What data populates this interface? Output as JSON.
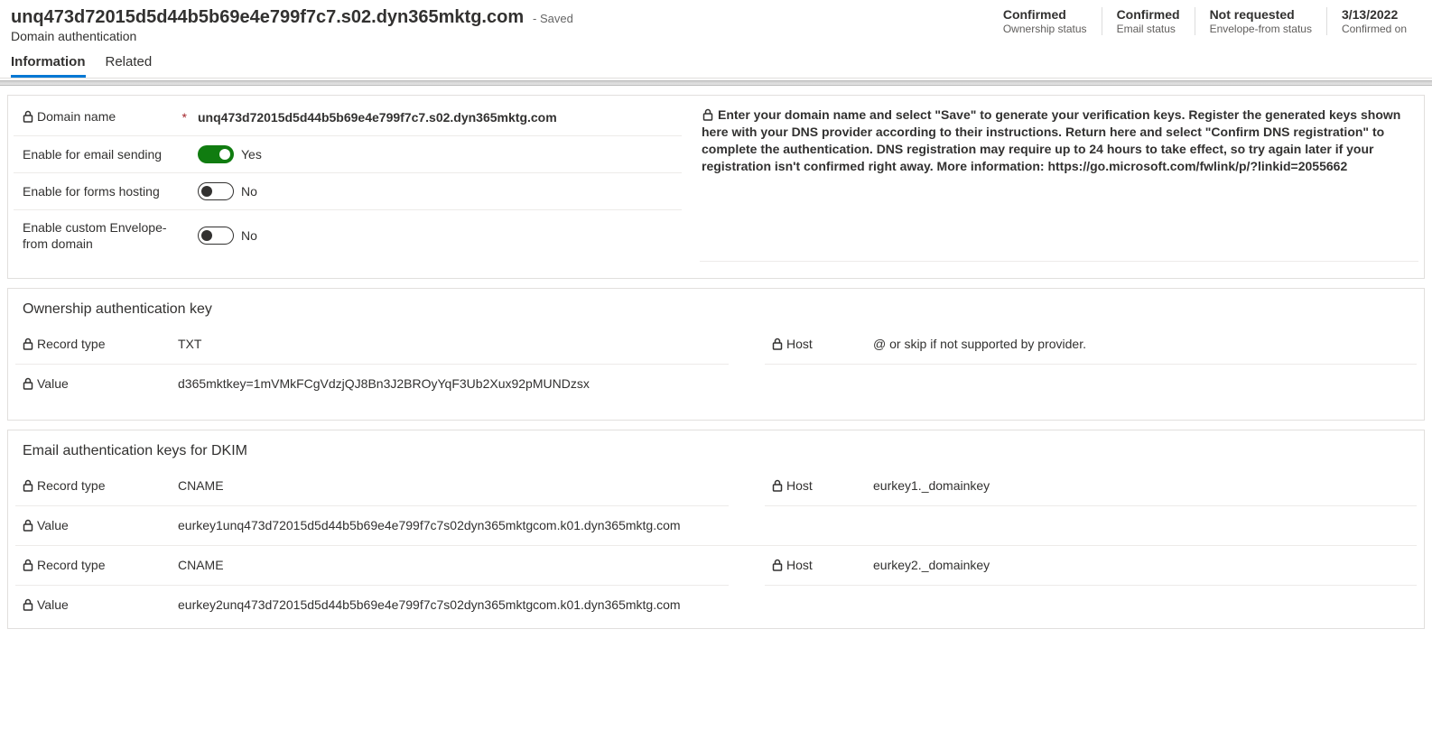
{
  "header": {
    "title": "unq473d72015d5d44b5b69e4e799f7c7.s02.dyn365mktg.com",
    "saved_label": "- Saved",
    "subtitle": "Domain authentication",
    "statuses": [
      {
        "value": "Confirmed",
        "label": "Ownership status"
      },
      {
        "value": "Confirmed",
        "label": "Email status"
      },
      {
        "value": "Not requested",
        "label": "Envelope-from status"
      },
      {
        "value": "3/13/2022",
        "label": "Confirmed on"
      }
    ]
  },
  "tabs": {
    "information": "Information",
    "related": "Related"
  },
  "form": {
    "domain_name_label": "Domain name",
    "domain_name_value": "unq473d72015d5d44b5b69e4e799f7c7.s02.dyn365mktg.com",
    "enable_email_label": "Enable for email sending",
    "enable_email_yes": "Yes",
    "enable_forms_label": "Enable for forms hosting",
    "enable_forms_no": "No",
    "enable_envelope_label": "Enable custom Envelope-from domain",
    "enable_envelope_no": "No",
    "info_banner": "Enter your domain name and select \"Save\" to generate your verification keys. Register the generated keys shown here with your DNS provider according to their instructions. Return here and select \"Confirm DNS registration\" to complete the authentication. DNS registration may require up to 24 hours to take effect, so try again later if your registration isn't confirmed right away. More information: https://go.microsoft.com/fwlink/p/?linkid=2055662"
  },
  "ownership": {
    "heading": "Ownership authentication key",
    "record_type_label": "Record type",
    "record_type_value": "TXT",
    "host_label": "Host",
    "host_value": "@ or skip if not supported by provider.",
    "value_label": "Value",
    "value_value": "d365mktkey=1mVMkFCgVdzjQJ8Bn3J2BROyYqF3Ub2Xux92pMUNDzsx"
  },
  "dkim": {
    "heading": "Email authentication keys for DKIM",
    "rows": [
      {
        "record_type_label": "Record type",
        "record_type": "CNAME",
        "host_label": "Host",
        "host": "eurkey1._domainkey",
        "value_label": "Value",
        "value": "eurkey1unq473d72015d5d44b5b69e4e799f7c7s02dyn365mktgcom.k01.dyn365mktg.com"
      },
      {
        "record_type_label": "Record type",
        "record_type": "CNAME",
        "host_label": "Host",
        "host": "eurkey2._domainkey",
        "value_label": "Value",
        "value": "eurkey2unq473d72015d5d44b5b69e4e799f7c7s02dyn365mktgcom.k01.dyn365mktg.com"
      }
    ]
  }
}
